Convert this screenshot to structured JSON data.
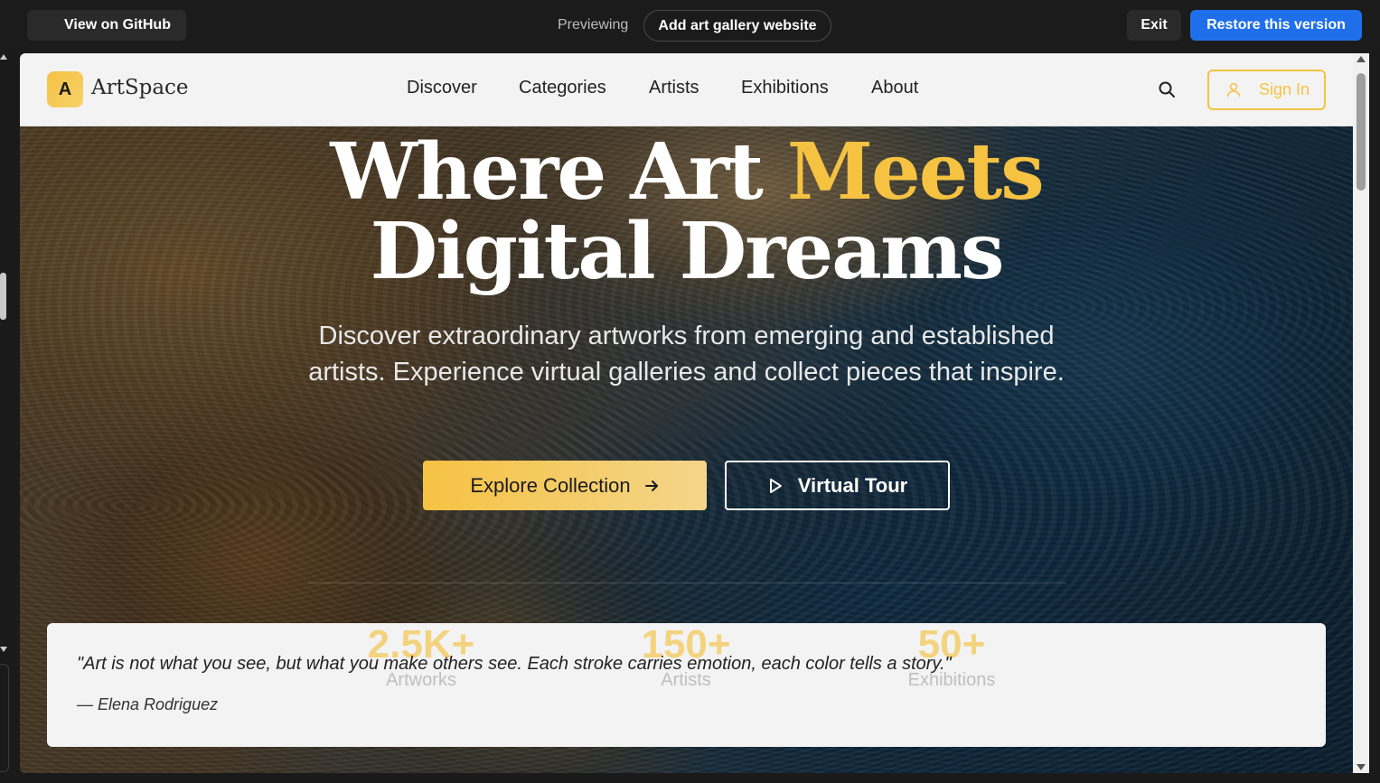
{
  "toolbar": {
    "github_label": "View on GitHub",
    "previewing_label": "Previewing",
    "version_label": "Add art gallery website",
    "exit_label": "Exit",
    "restore_label": "Restore this version"
  },
  "site": {
    "logo_letter": "A",
    "logo_text": "ArtSpace",
    "nav": [
      "Discover",
      "Categories",
      "Artists",
      "Exhibitions",
      "About"
    ],
    "signin_label": "Sign In",
    "accent_color": "#f5c242"
  },
  "hero": {
    "headline_part1": "Where Art ",
    "headline_accent": "Meets",
    "headline_part2": "Digital Dreams",
    "subtext": "Discover extraordinary artworks from emerging and established artists. Experience virtual galleries and collect pieces that inspire.",
    "cta_primary": "Explore Collection",
    "cta_secondary": "Virtual Tour"
  },
  "stats": [
    {
      "value": "2.5K+",
      "label": "Artworks"
    },
    {
      "value": "150+",
      "label": "Artists"
    },
    {
      "value": "50+",
      "label": "Exhibitions"
    }
  ],
  "quote": {
    "text": "\"Art is not what you see, but what you make others see. Each stroke carries emotion, each color tells a story.\"",
    "author": "— Elena Rodriguez"
  }
}
